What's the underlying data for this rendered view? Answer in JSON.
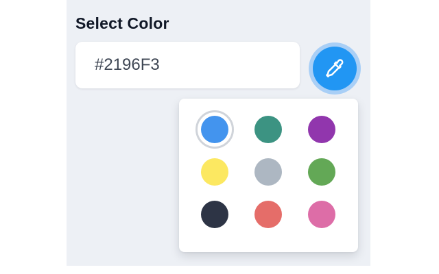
{
  "label": "Select Color",
  "input": {
    "value": "#2196F3"
  },
  "picker_button": {
    "icon": "eyedropper-icon",
    "color": "#2196F3"
  },
  "palette": {
    "selected_index": 0,
    "swatches": [
      {
        "name": "blue",
        "color": "#4394EE"
      },
      {
        "name": "teal",
        "color": "#3C9382"
      },
      {
        "name": "purple",
        "color": "#9136AD"
      },
      {
        "name": "yellow",
        "color": "#FCE861"
      },
      {
        "name": "gray",
        "color": "#ADB7C2"
      },
      {
        "name": "green",
        "color": "#63A856"
      },
      {
        "name": "dark-navy",
        "color": "#2D3445"
      },
      {
        "name": "coral-red",
        "color": "#E56D69"
      },
      {
        "name": "pink",
        "color": "#DD6DA7"
      }
    ]
  }
}
